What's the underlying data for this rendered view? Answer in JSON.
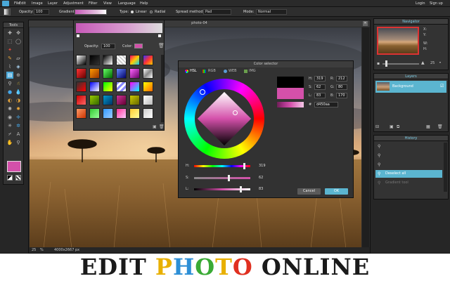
{
  "menubar": {
    "items": [
      "File",
      "Edit",
      "Image",
      "Layer",
      "Adjustment",
      "Filter",
      "View",
      "Language",
      "Help"
    ],
    "login": "Login",
    "signup": "Sign up"
  },
  "toolbar": {
    "opacity_label": "Opacity:",
    "opacity_value": "100",
    "gradient_label": "Gradient:",
    "type_label": "Type:",
    "type_linear": "Linear",
    "type_radial": "Radial",
    "spread_label": "Spread method:",
    "spread_value": "Pad",
    "mode_label": "Mode:",
    "mode_value": "Normal"
  },
  "tools": {
    "title": "Tools"
  },
  "gradient_panel": {
    "opacity_label": "Opacity:",
    "opacity_value": "100",
    "color_label": "Color:"
  },
  "canvas": {
    "title": "photo-04",
    "zoom": "25",
    "zoom_unit": "%",
    "size": "4000x2667 px"
  },
  "color_selector": {
    "title": "Color selector",
    "tabs": [
      "HSL",
      "RGB",
      "WEB",
      "IMG"
    ],
    "h_label": "H:",
    "h_value": "319",
    "s_label": "S:",
    "s_value": "62",
    "l_label": "L:",
    "l_value": "83",
    "h2_label": "H:",
    "h2_value": "319",
    "s2_label": "S:",
    "s2_value": "62",
    "l2_label": "L:",
    "l2_value": "83",
    "r_label": "R:",
    "r_value": "212",
    "g_label": "G:",
    "g_value": "80",
    "b_label": "B:",
    "b_value": "170",
    "hash": "#",
    "hex": "d450aa",
    "cancel": "Cancel",
    "ok": "OK",
    "h_fraction": 0.89,
    "s_fraction": 0.62,
    "l_fraction": 0.83
  },
  "navigator": {
    "title": "Navigator",
    "x_label": "X:",
    "y_label": "Y:",
    "w_label": "W:",
    "h_label": "H:",
    "zoom_value": "25",
    "zoom_fraction": 0.1
  },
  "layers": {
    "title": "Layers",
    "items": [
      "Background"
    ]
  },
  "history": {
    "title": "History",
    "items": [
      "",
      "",
      "",
      "Deselect all",
      "Gradient tool"
    ],
    "selected_index": 3
  },
  "banner": {
    "parts": [
      {
        "text": "EDIT",
        "color": "#1a1a1a"
      },
      {
        "text": "P",
        "color": "#e8b000"
      },
      {
        "text": "H",
        "color": "#2d8fd6"
      },
      {
        "text": "O",
        "color": "#3aaa35"
      },
      {
        "text": "T",
        "color": "#e8b000"
      },
      {
        "text": "O",
        "color": "#e03020"
      },
      {
        "text": "ONLINE",
        "color": "#1a1a1a"
      }
    ]
  },
  "colors": {
    "accent": "#5bb5d0",
    "selected_color": "#d450aa"
  }
}
